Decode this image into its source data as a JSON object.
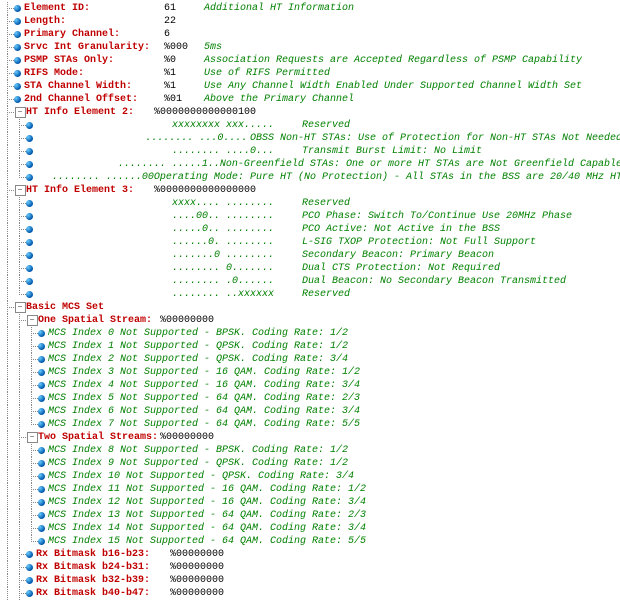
{
  "elementId": {
    "label": "Element ID:",
    "value": "61",
    "desc": "Additional HT Information"
  },
  "length": {
    "label": "Length:",
    "value": "22"
  },
  "primaryChannel": {
    "label": "Primary Channel:",
    "value": "6"
  },
  "srvcIntGran": {
    "label": "Srvc Int Granularity:",
    "value": "%000",
    "desc": "5ms"
  },
  "psmp": {
    "label": "PSMP STAs Only:",
    "value": "%0",
    "desc": "Association Requests are Accepted Regardless of PSMP Capability"
  },
  "rifs": {
    "label": "RIFS Mode:",
    "value": "%1",
    "desc": "Use of RIFS Permitted"
  },
  "staChWidth": {
    "label": "STA Channel Width:",
    "value": "%1",
    "desc": "Use Any Channel Width Enabled Under Supported Channel Width Set"
  },
  "secChOffset": {
    "label": "2nd Channel Offset:",
    "value": "%01",
    "desc": "Above the Primary Channel"
  },
  "ht2": {
    "label": "HT Info Element 2:",
    "value": "%0000000000000100",
    "bits": [
      {
        "v": "xxxxxxxx xxx.....",
        "d": "Reserved"
      },
      {
        "v": "........ ...0....",
        "d": "OBSS Non-HT STAs: Use of Protection for Non-HT STAs Not Needed"
      },
      {
        "v": "........ ....0...",
        "d": "Transmit Burst Limit: No Limit"
      },
      {
        "v": "........ .....1..",
        "d": "Non-Greenfield STAs: One or more HT STAs are Not Greenfield Capable"
      },
      {
        "v": "........ ......00",
        "d": "Operating Mode: Pure HT (No Protection) - All STAs in the BSS are 20/40 MHz HT"
      }
    ]
  },
  "ht3": {
    "label": "HT Info Element 3:",
    "value": "%0000000000000000",
    "bits": [
      {
        "v": "xxxx.... ........",
        "d": "Reserved"
      },
      {
        "v": "....00.. ........",
        "d": "PCO Phase: Switch To/Continue Use 20MHz Phase"
      },
      {
        "v": ".....0.. ........",
        "d": "PCO Active: Not Active in the BSS"
      },
      {
        "v": "......0. ........",
        "d": "L-SIG TXOP Protection: Not Full Support"
      },
      {
        "v": ".......0 ........",
        "d": "Secondary Beacon: Primary Beacon"
      },
      {
        "v": "........ 0.......",
        "d": "Dual CTS Protection: Not Required"
      },
      {
        "v": "........ .0......",
        "d": "Dual Beacon: No Secondary Beacon Transmitted"
      },
      {
        "v": "........ ..xxxxxx",
        "d": "Reserved"
      }
    ]
  },
  "basicMcs": {
    "label": "Basic MCS Set"
  },
  "ss1": {
    "label": "One Spatial Stream:",
    "value": "%00000000",
    "items": [
      "MCS Index 0 Not Supported - BPSK. Coding Rate: 1/2",
      "MCS Index 1 Not Supported - QPSK. Coding Rate: 1/2",
      "MCS Index 2 Not Supported - QPSK. Coding Rate: 3/4",
      "MCS Index 3 Not Supported - 16 QAM. Coding Rate: 1/2",
      "MCS Index 4 Not Supported - 16 QAM. Coding Rate: 3/4",
      "MCS Index 5 Not Supported - 64 QAM. Coding Rate: 2/3",
      "MCS Index 6 Not Supported - 64 QAM. Coding Rate: 3/4",
      "MCS Index 7 Not Supported - 64 QAM. Coding Rate: 5/5"
    ]
  },
  "ss2": {
    "label": "Two Spatial Streams:",
    "value": "%00000000",
    "items": [
      "MCS Index 8 Not Supported - BPSK. Coding Rate: 1/2",
      "MCS Index 9 Not Supported - QPSK. Coding Rate: 1/2",
      "MCS Index 10 Not Supported - QPSK. Coding Rate: 3/4",
      "MCS Index 11 Not Supported - 16 QAM. Coding Rate: 1/2",
      "MCS Index 12 Not Supported - 16 QAM. Coding Rate: 3/4",
      "MCS Index 13 Not Supported - 64 QAM. Coding Rate: 2/3",
      "MCS Index 14 Not Supported - 64 QAM. Coding Rate: 3/4",
      "MCS Index 15 Not Supported - 64 QAM. Coding Rate: 5/5"
    ]
  },
  "rxb": [
    {
      "label": "Rx Bitmask b16-b23:",
      "value": "%00000000"
    },
    {
      "label": "Rx Bitmask b24-b31:",
      "value": "%00000000"
    },
    {
      "label": "Rx Bitmask b32-b39:",
      "value": "%00000000"
    },
    {
      "label": "Rx Bitmask b40-b47:",
      "value": "%00000000"
    }
  ]
}
